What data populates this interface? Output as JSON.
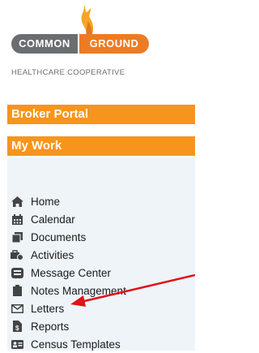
{
  "logo": {
    "left_text": "COMMON",
    "right_text": "GROUND",
    "tagline": "HEALTHCARE COOPERATIVE"
  },
  "headers": {
    "portal": "Broker Portal",
    "work": "My Work"
  },
  "menu": {
    "items": [
      {
        "label": "Home",
        "icon": "home-icon"
      },
      {
        "label": "Calendar",
        "icon": "calendar-icon"
      },
      {
        "label": "Documents",
        "icon": "documents-icon"
      },
      {
        "label": "Activities",
        "icon": "activities-icon"
      },
      {
        "label": "Message Center",
        "icon": "message-icon"
      },
      {
        "label": "Notes Management",
        "icon": "clipboard-icon"
      },
      {
        "label": "Letters",
        "icon": "envelope-icon"
      },
      {
        "label": "Reports",
        "icon": "report-icon"
      },
      {
        "label": "Census Templates",
        "icon": "id-card-icon"
      }
    ]
  },
  "colors": {
    "header_orange": "#f7941d",
    "logo_gray": "#6b6e71",
    "logo_orange": "#ee7b22",
    "menu_bg": "#eef4f8",
    "annotation_arrow": "#e0121b"
  }
}
